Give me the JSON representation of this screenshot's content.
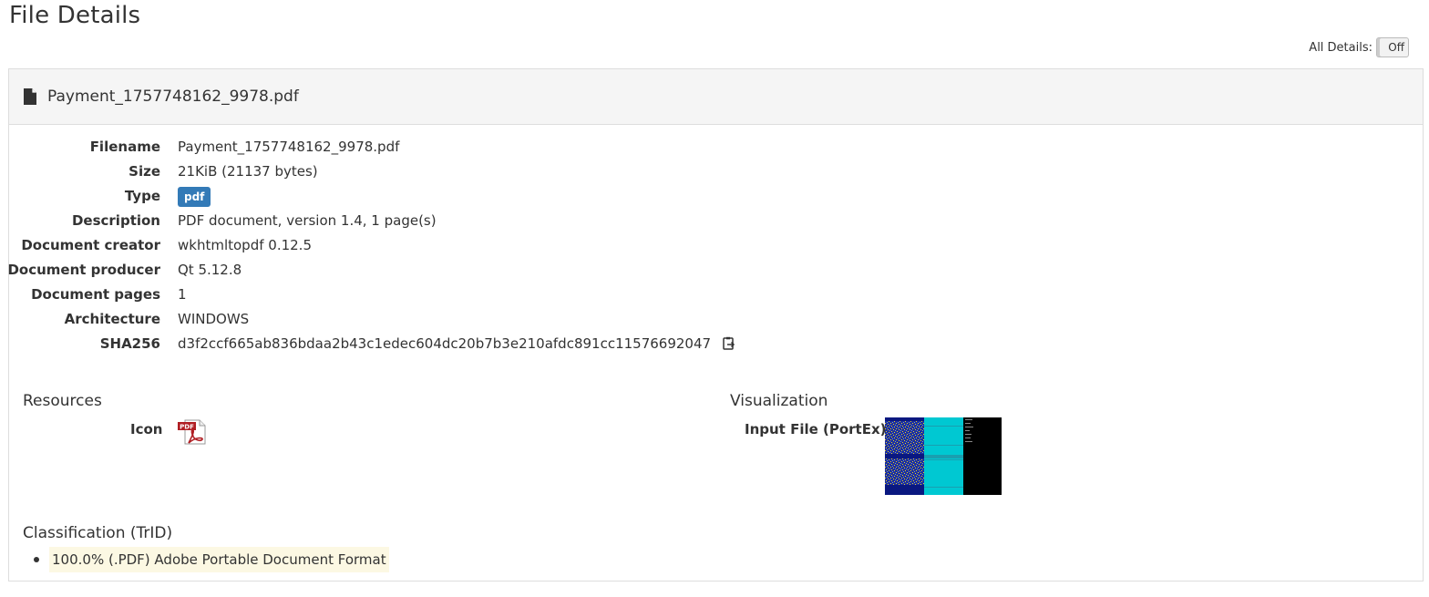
{
  "page_title": "File Details",
  "all_details": {
    "label": "All Details:",
    "toggle_state": "Off"
  },
  "file": {
    "header_name": "Payment_1757748162_9978.pdf",
    "fields": [
      {
        "label": "Filename",
        "value": "Payment_1757748162_9978.pdf"
      },
      {
        "label": "Size",
        "value": "21KiB (21137 bytes)"
      },
      {
        "label": "Type",
        "value": "pdf"
      },
      {
        "label": "Description",
        "value": "PDF document, version 1.4, 1 page(s)"
      },
      {
        "label": "Document creator",
        "value": "wkhtmltopdf 0.12.5"
      },
      {
        "label": "Document producer",
        "value": "Qt 5.12.8"
      },
      {
        "label": "Document pages",
        "value": "1"
      },
      {
        "label": "Architecture",
        "value": "WINDOWS"
      },
      {
        "label": "SHA256",
        "value": "d3f2ccf665ab836bdaa2b43c1edec604dc20b7b3e210afdc891cc11576692047"
      }
    ]
  },
  "resources": {
    "title": "Resources",
    "icon_label": "Icon",
    "icon_name": "pdf-file-icon"
  },
  "visualization": {
    "title": "Visualization",
    "input_label": "Input File (PortEx)"
  },
  "classification": {
    "title": "Classification (TrID)",
    "items": [
      "100.0% (.PDF) Adobe Portable Document Format"
    ]
  },
  "colors": {
    "badge": "#337ab7",
    "highlight": "#fcf8e3",
    "panel_header": "#f5f5f5"
  }
}
